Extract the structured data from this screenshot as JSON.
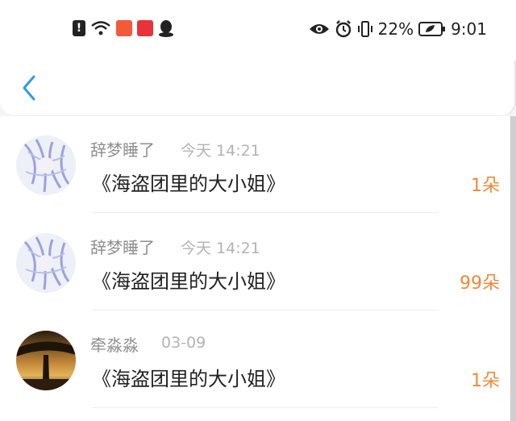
{
  "status_bar": {
    "battery": "22%",
    "time": "9:01",
    "left_icons": [
      "alert-icon",
      "wifi-icon",
      "app-icon-1",
      "app-icon-2",
      "qq-icon"
    ],
    "right_icons": [
      "eye-icon",
      "alarm-icon",
      "vibrate-icon",
      "battery-icon"
    ]
  },
  "nav": {
    "back_icon": "chevron-left-icon",
    "accent": "#2f9be8"
  },
  "rows": [
    {
      "name": "辞梦睡了",
      "time": "今天 14:21",
      "title": "《海盗团里的大小姐》",
      "count": "1朵",
      "avatar": "anime-avatar"
    },
    {
      "name": "辞梦睡了",
      "time": "今天 14:21",
      "title": "《海盗团里的大小姐》",
      "count": "99朵",
      "avatar": "anime-avatar"
    },
    {
      "name": "牵淼淼",
      "time": "03-09",
      "title": "《海盗团里的大小姐》",
      "count": "1朵",
      "avatar": "tree-sunset-avatar"
    }
  ],
  "colors": {
    "count": "#f0883a",
    "name": "#8e8e8e",
    "time": "#b3b3b3"
  }
}
